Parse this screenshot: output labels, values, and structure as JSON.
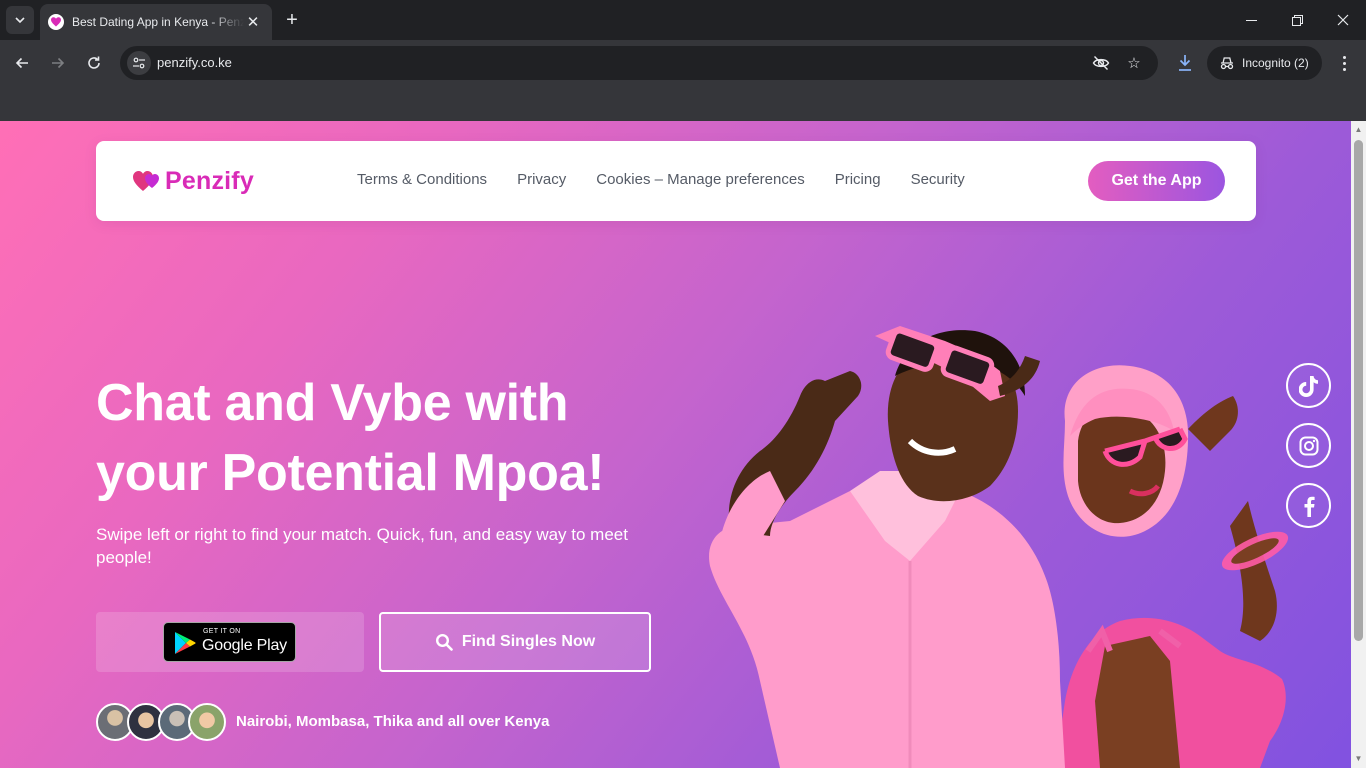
{
  "browser": {
    "tab_title": "Best Dating App in Kenya - Penzify",
    "url": "penzify.co.ke",
    "incognito_label": "Incognito (2)"
  },
  "site": {
    "logo_text": "Penzify",
    "nav": [
      "Terms & Conditions",
      "Privacy",
      "Cookies – Manage preferences",
      "Pricing",
      "Security"
    ],
    "cta": "Get the App"
  },
  "hero": {
    "title_line1": "Chat and Vybe with",
    "title_line2": "your Potential Mpoa!",
    "subtitle": "Swipe left or right to find your match. Quick, fun, and easy way to meet people!",
    "play_small": "GET IT ON",
    "play_big": "Google Play",
    "find_button": "Find Singles Now",
    "locations": "Nairobi, Mombasa, Thika and all over Kenya"
  },
  "social": [
    "tiktok-icon",
    "instagram-icon",
    "facebook-icon"
  ],
  "colors": {
    "brand": "#d92bb7",
    "gradient_start": "#ff6fb6",
    "gradient_end": "#8152e0",
    "chrome_dark": "#202124",
    "chrome_toolbar": "#35363a"
  }
}
